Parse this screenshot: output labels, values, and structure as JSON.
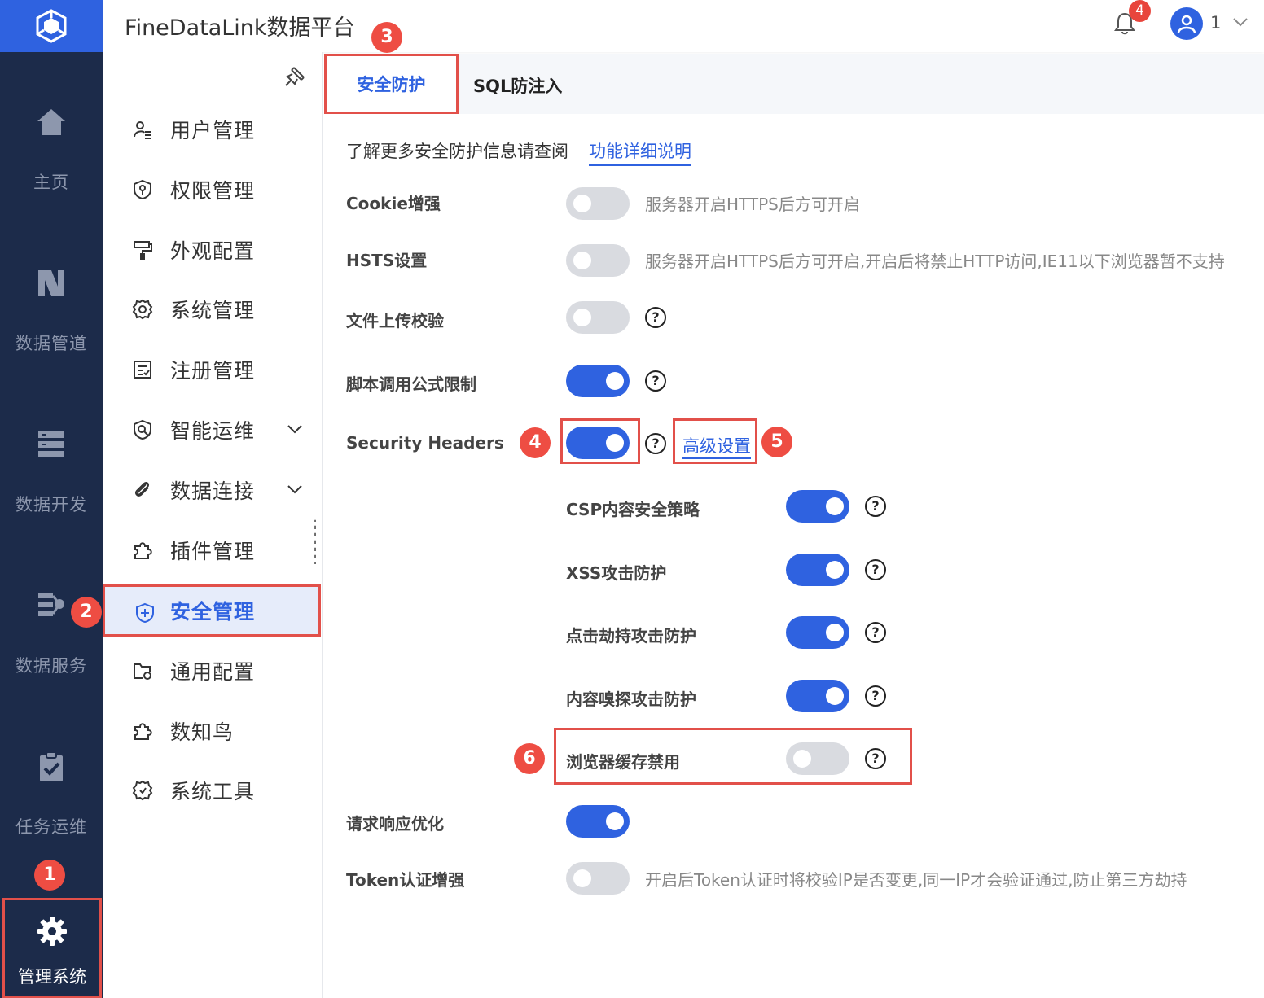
{
  "app": {
    "title": "FineDataLink数据平台",
    "notification_count": "4",
    "user_name": "1"
  },
  "rail": {
    "items": [
      {
        "label": "主页",
        "icon": "home-icon"
      },
      {
        "label": "数据管道",
        "icon": "pipeline-icon"
      },
      {
        "label": "数据开发",
        "icon": "develop-icon"
      },
      {
        "label": "数据服务",
        "icon": "service-icon"
      },
      {
        "label": "任务运维",
        "icon": "task-ops-icon"
      }
    ],
    "admin_label": "管理系统"
  },
  "menu": {
    "items": [
      {
        "label": "用户管理"
      },
      {
        "label": "权限管理"
      },
      {
        "label": "外观配置"
      },
      {
        "label": "系统管理"
      },
      {
        "label": "注册管理"
      },
      {
        "label": "智能运维"
      },
      {
        "label": "数据连接"
      },
      {
        "label": "插件管理"
      },
      {
        "label": "安全管理"
      },
      {
        "label": "通用配置"
      },
      {
        "label": "数知鸟"
      },
      {
        "label": "系统工具"
      }
    ],
    "active": "安全管理"
  },
  "tabs": {
    "active": "安全防护",
    "other": "SQL防注入"
  },
  "intro": {
    "text": "了解更多安全防护信息请查阅",
    "link": "功能详细说明"
  },
  "settings": {
    "cookie": {
      "label": "Cookie增强",
      "on": false,
      "hint": "服务器开启HTTPS后方可开启"
    },
    "hsts": {
      "label": "HSTS设置",
      "on": false,
      "hint": "服务器开启HTTPS后方可开启,开启后将禁止HTTP访问,IE11以下浏览器暂不支持"
    },
    "upload": {
      "label": "文件上传校验",
      "on": false
    },
    "script": {
      "label": "脚本调用公式限制",
      "on": true
    },
    "headers": {
      "label": "Security Headers",
      "on": true,
      "advanced": "高级设置"
    },
    "csp": {
      "label": "CSP内容安全策略",
      "on": true
    },
    "xss": {
      "label": "XSS攻击防护",
      "on": true
    },
    "clickjack": {
      "label": "点击劫持攻击防护",
      "on": true
    },
    "sniff": {
      "label": "内容嗅探攻击防护",
      "on": true
    },
    "cache": {
      "label": "浏览器缓存禁用",
      "on": false
    },
    "response": {
      "label": "请求响应优化",
      "on": true
    },
    "token": {
      "label": "Token认证增强",
      "on": false,
      "hint": "开启后Token认证时将校验IP是否变更,同一IP才会验证通过,防止第三方劫持"
    }
  },
  "annotations": [
    "1",
    "2",
    "3",
    "4",
    "5",
    "6"
  ],
  "colors": {
    "accent": "#2f62e0",
    "rail": "#1c2b4a",
    "annotation": "#e2504a"
  }
}
